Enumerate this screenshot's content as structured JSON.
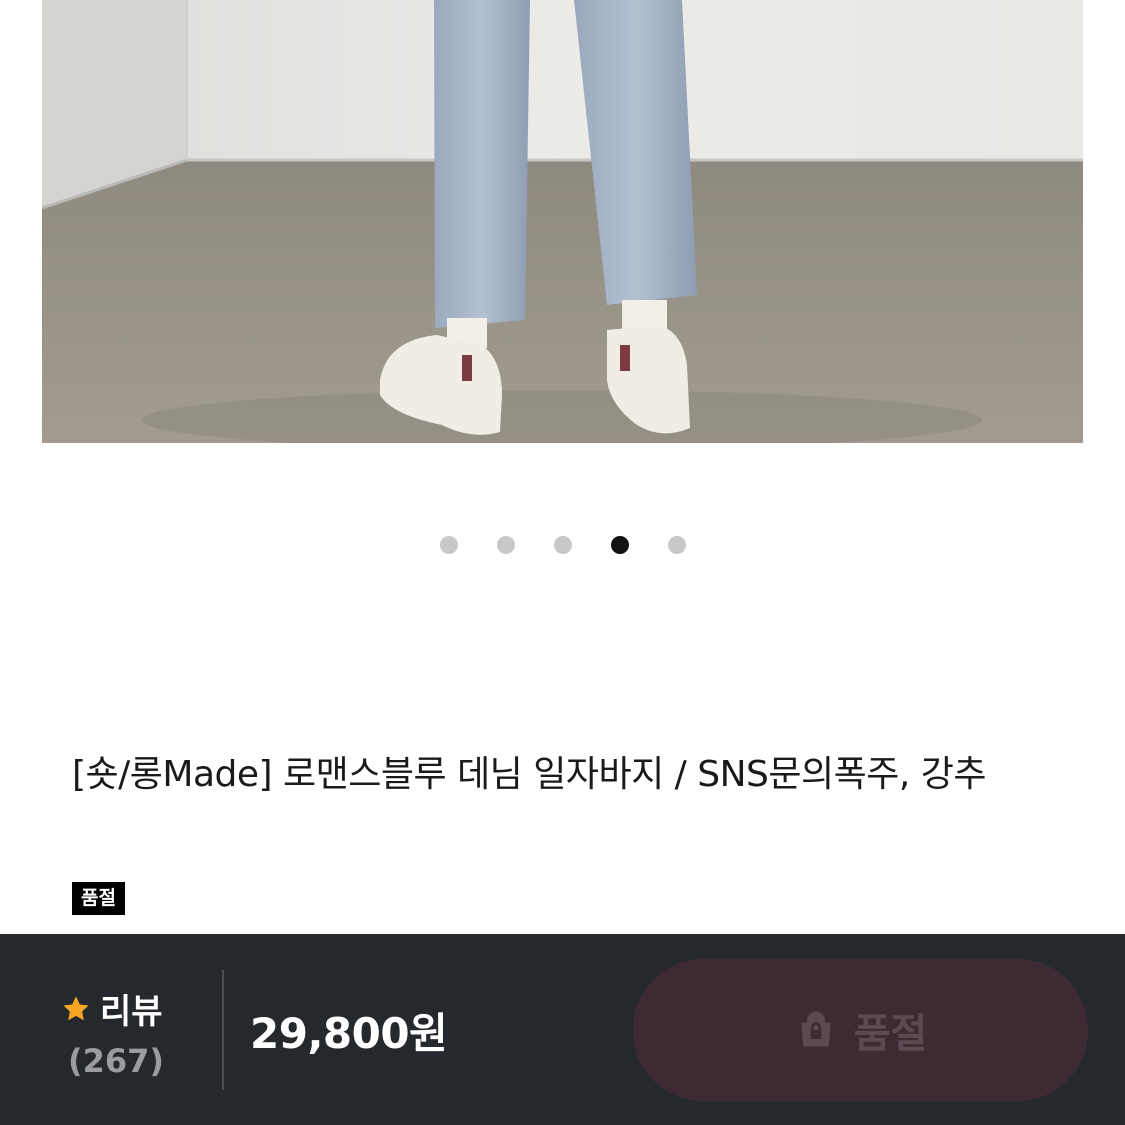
{
  "product": {
    "title": "[숏/롱Made] 로맨스블루 데님 일자바지 / SNS문의폭주, 강추",
    "badge": "품절"
  },
  "carousel": {
    "total": 5,
    "active_index": 3
  },
  "bottom_bar": {
    "review_label": "리뷰",
    "review_count": "(267)",
    "price": "29,800원",
    "button_label": "품절"
  },
  "icons": {
    "review": "star-icon",
    "button": "shopping-bag-lock-icon"
  },
  "colors": {
    "star": "#f5a623",
    "bar_background": "#25282d",
    "button_background": "#3e2a33"
  }
}
